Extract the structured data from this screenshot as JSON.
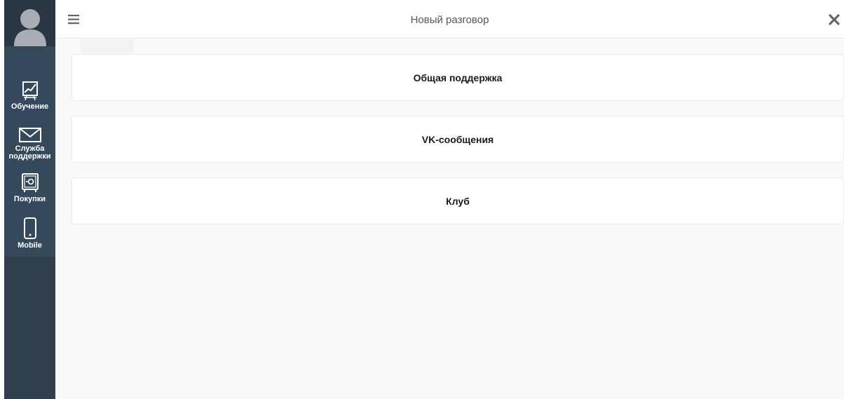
{
  "header": {
    "title": "Новый разговор",
    "menu_icon": "hamburger-menu-icon",
    "close_icon": "close-icon"
  },
  "sidebar": {
    "avatar_icon": "user-avatar-icon",
    "items": [
      {
        "label": "Обучение",
        "icon": "chart-board-icon"
      },
      {
        "label": "Служба поддержки",
        "icon": "envelope-icon"
      },
      {
        "label": "Покупки",
        "icon": "safe-icon"
      },
      {
        "label": "Mobile",
        "icon": "mobile-phone-icon"
      }
    ]
  },
  "options": [
    {
      "label": "Общая поддержка"
    },
    {
      "label": "VK-сообщения"
    },
    {
      "label": "Клуб"
    }
  ],
  "colors": {
    "sidebar_bg": "#2f3d4c",
    "nav_strip_bg": "#34495c",
    "content_bg": "#f9f9f9",
    "card_bg": "#ffffff"
  }
}
